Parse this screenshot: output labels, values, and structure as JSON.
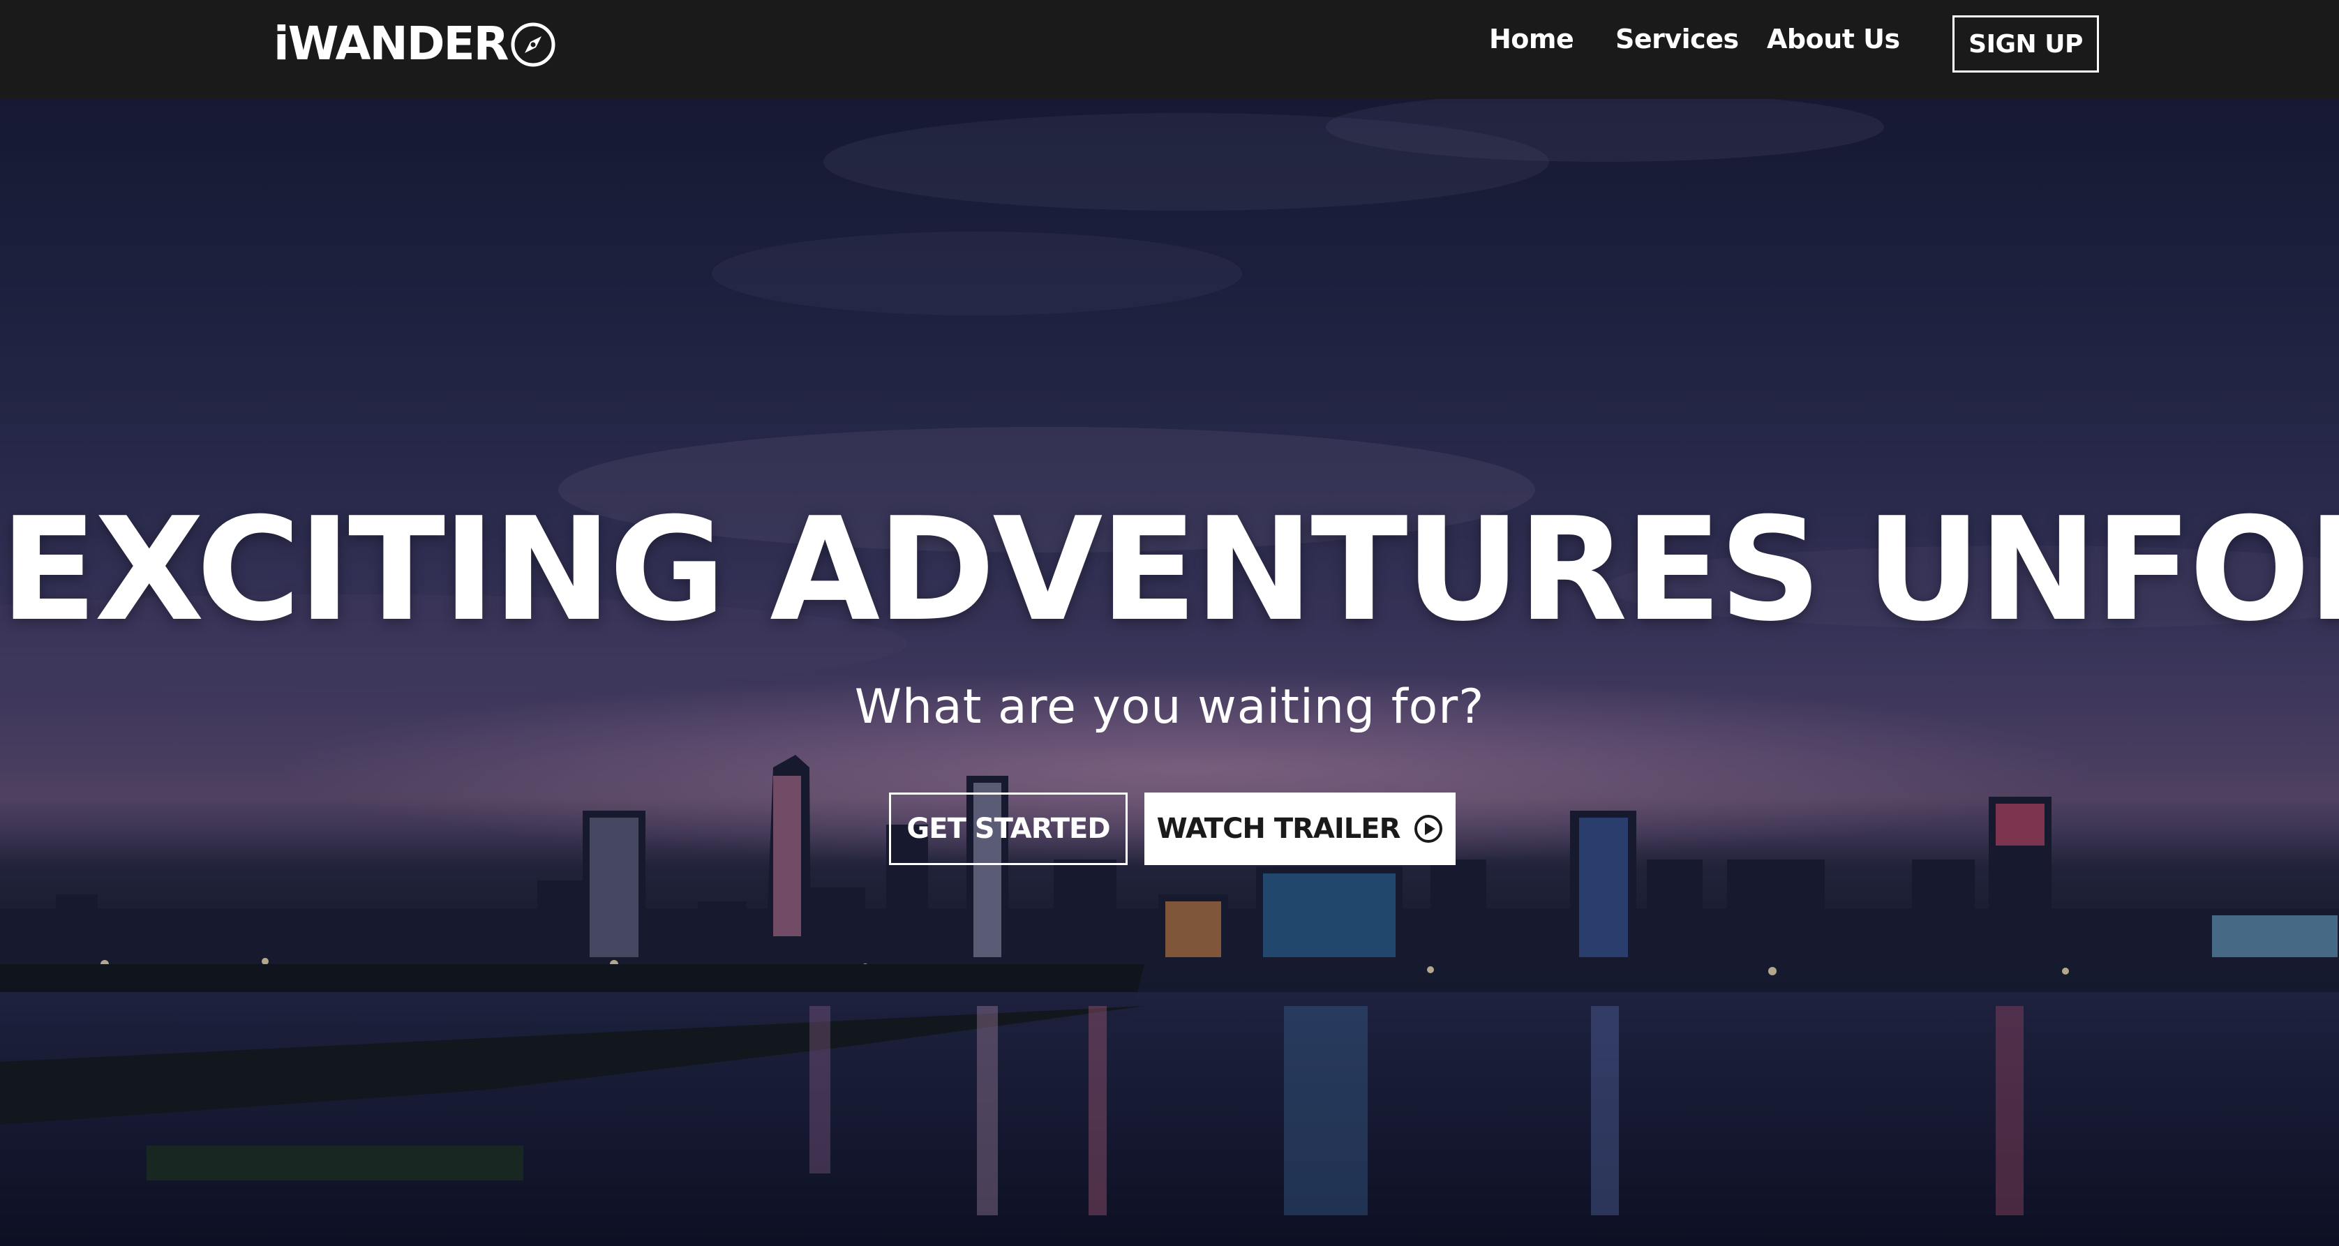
{
  "navbar": {
    "logo_text": "iWANDER",
    "logo_icon": "compass-icon",
    "links": {
      "home": "Home",
      "services": "Services",
      "about": "About Us"
    },
    "signup_label": "SIGN UP"
  },
  "hero": {
    "title": "EXCITING ADVENTURES UNFOLD",
    "subtitle": "What are you waiting for?",
    "primary_button": "GET STARTED",
    "secondary_button": "WATCH TRAILER",
    "secondary_button_icon": "play-circle-icon",
    "background_description_icon": "city-skyline-night-image"
  },
  "colors": {
    "navbar_bg": "#1a1a1a",
    "text": "#ffffff",
    "button_fill": "#ffffff",
    "button_fill_text": "#1a1a1a"
  }
}
